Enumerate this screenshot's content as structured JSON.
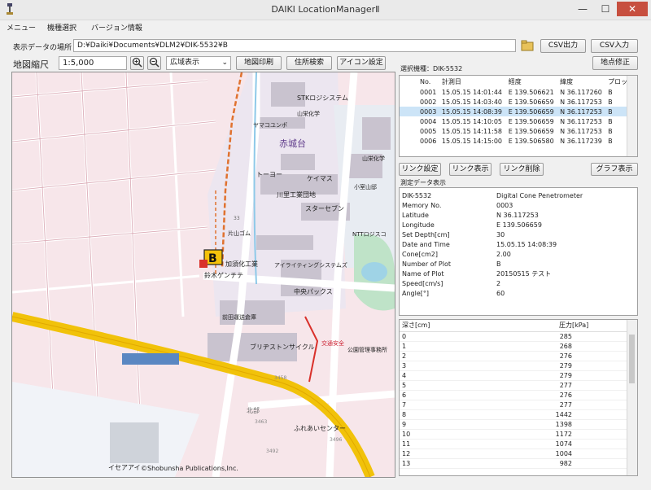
{
  "window": {
    "title": "DAIKI LocationManagerⅡ",
    "minimize": "—",
    "maximize": "☐",
    "close": "✕"
  },
  "menu": [
    "メニュー",
    "機種選択",
    "バージョン情報"
  ],
  "path": {
    "label": "表示データの場所",
    "value": "D:¥Daiki¥Documents¥DLM2¥DIK-5532¥B"
  },
  "toolbar": {
    "csv_out": "CSV出力",
    "csv_in": "CSV入力",
    "scale_label": "地図縮尺",
    "scale_value": "1:5,000",
    "map_mode": "広域表示",
    "print": "地図印刷",
    "address_search": "住所検索",
    "icon_settings": "アイコン設定",
    "point_edit": "地点修正"
  },
  "device": {
    "label": "選択機種：DIK-5532"
  },
  "measure_list": {
    "headers": [
      "No.",
      "計測日",
      "経度",
      "緯度",
      "プロット"
    ],
    "rows": [
      [
        "0001",
        "15.05.15 14:01:44",
        "E 139.506621",
        "N 36.117260",
        "B"
      ],
      [
        "0002",
        "15.05.15 14:03:40",
        "E 139.506659",
        "N 36.117253",
        "B"
      ],
      [
        "0003",
        "15.05.15 14:08:39",
        "E 139.506659",
        "N 36.117253",
        "B"
      ],
      [
        "0004",
        "15.05.15 14:10:05",
        "E 139.506659",
        "N 36.117253",
        "B"
      ],
      [
        "0005",
        "15.05.15 14:11:58",
        "E 139.506659",
        "N 36.117253",
        "B"
      ],
      [
        "0006",
        "15.05.15 14:15:00",
        "E 139.506580",
        "N 36.117239",
        "B"
      ]
    ],
    "selected_index": 2
  },
  "link_buttons": {
    "set": "リンク設定",
    "show": "リンク表示",
    "delete": "リンク削除",
    "graph": "グラフ表示"
  },
  "detail": {
    "label": "測定データ表示",
    "rows": [
      [
        "DIK-5532",
        "Digital Cone Penetrometer"
      ],
      [
        "Memory No.",
        "0003"
      ],
      [
        "Latitude",
        "N 36.117253"
      ],
      [
        "Longitude",
        "E 139.506659"
      ],
      [
        "Set Depth[cm]",
        "30"
      ],
      [
        "Date and Time",
        "15.05.15 14:08:39"
      ],
      [
        "Cone[cm2]",
        "2.00"
      ],
      [
        "Number of Plot",
        "B"
      ],
      [
        "Name of Plot",
        "20150515 テスト"
      ],
      [
        "Speed[cm/s]",
        "2"
      ],
      [
        "Angle[°]",
        "60"
      ]
    ]
  },
  "pressure": {
    "headers": [
      "深さ[cm]",
      "圧力[kPa]"
    ],
    "rows": [
      [
        "0",
        "285"
      ],
      [
        "1",
        "268"
      ],
      [
        "2",
        "276"
      ],
      [
        "3",
        "279"
      ],
      [
        "4",
        "279"
      ],
      [
        "5",
        "277"
      ],
      [
        "6",
        "276"
      ],
      [
        "7",
        "277"
      ],
      [
        "8",
        "1442"
      ],
      [
        "9",
        "1398"
      ],
      [
        "10",
        "1172"
      ],
      [
        "11",
        "1074"
      ],
      [
        "12",
        "1004"
      ],
      [
        "13",
        "982"
      ]
    ]
  },
  "map": {
    "marker": "B",
    "labels": {
      "stk": "STKロジシステム",
      "hanaken": "山栄化学",
      "toyo": "ヤマコユンポ",
      "akagidai": "赤城台",
      "keimasu": "ケイマス",
      "kawashima": "川里工業団地",
      "tooyo": "トーヨー",
      "sanei": "山栄化学",
      "kohoku": "小室山邸",
      "starseven": "スターセブン",
      "ntt": "NTTロジスコ",
      "fukuyama": "片山ゴム",
      "kazo": "加須化工業",
      "suzuki": "鈴木ゲンチテ",
      "airaiting": "アイライティングシステムズ",
      "chuou": "中央パックス",
      "maeda": "前田運送倉庫",
      "bridgestone": "ブリヂストンサイクル",
      "kotsu": "交通安全",
      "heisei": "公園管理事務所",
      "hokoku": "北部",
      "fureai": "ふれあいセンター",
      "num1": "3463",
      "num2": "3458",
      "num3": "3492",
      "num4": "3496",
      "num5": "33",
      "copyright": "©Shobunsha Publications,Inc.",
      "igata": "イセアアイ"
    }
  }
}
